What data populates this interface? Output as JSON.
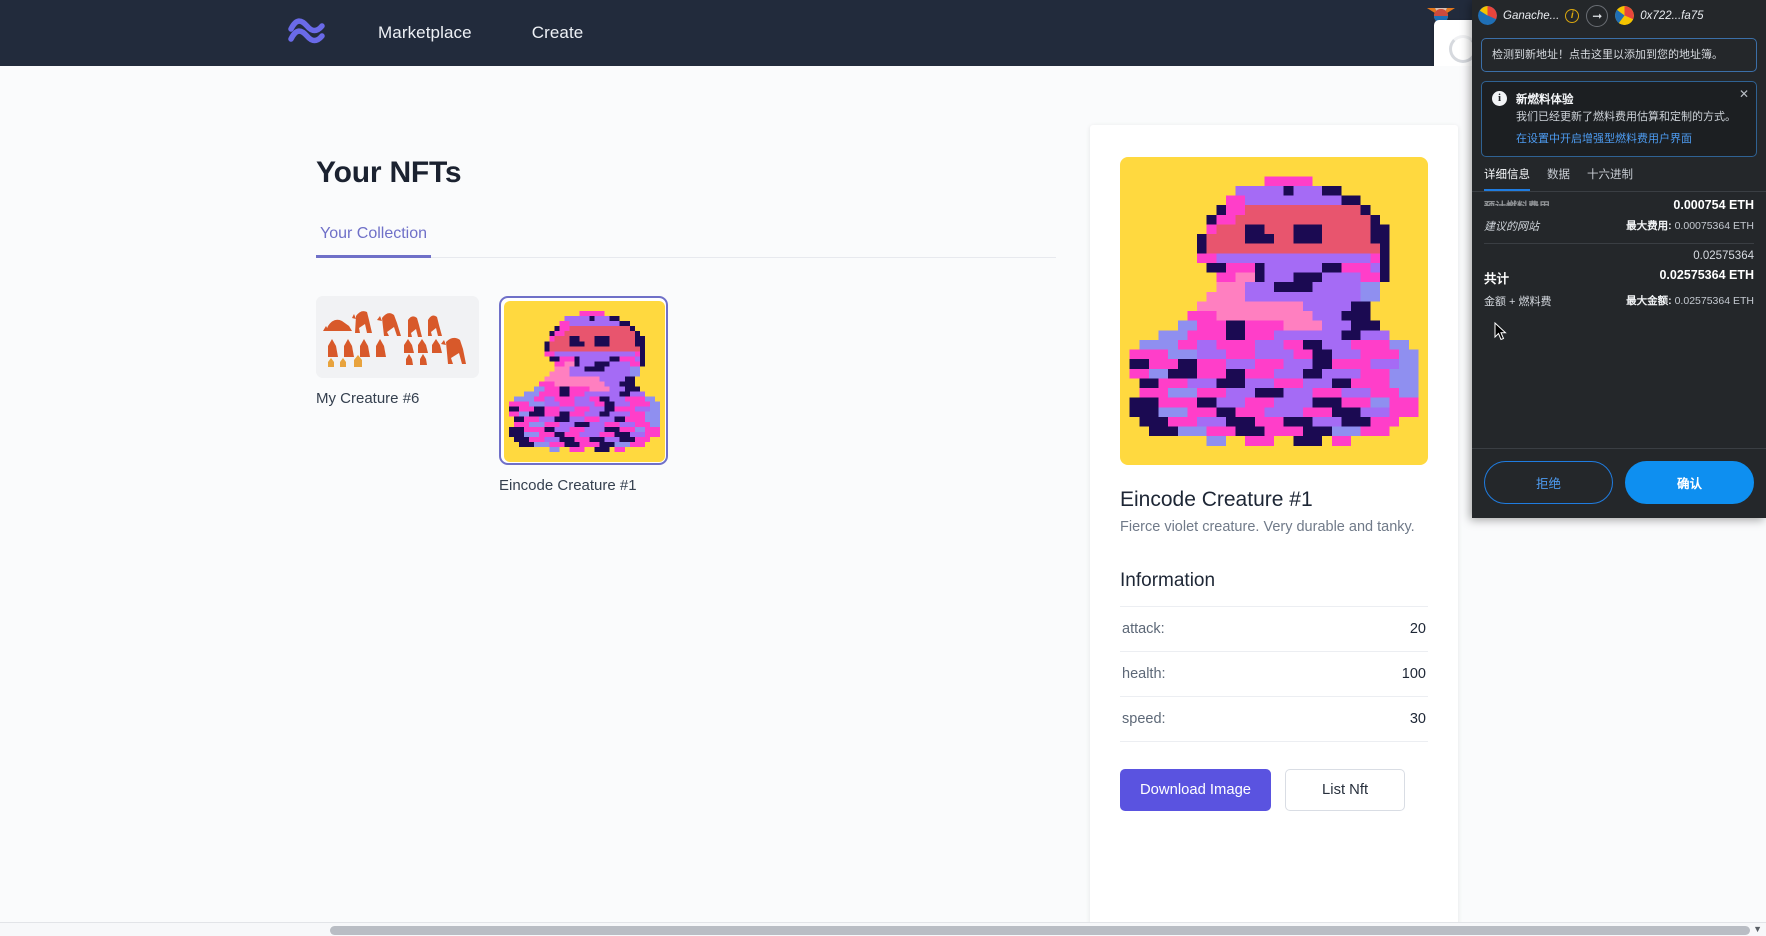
{
  "navbar": {
    "logo_icon": "wave-logo-icon",
    "links": [
      {
        "label": "Marketplace"
      },
      {
        "label": "Create"
      }
    ],
    "network_badge": {
      "label": "Ganache",
      "dot_color": "#6b5bd6",
      "bg": "#f3eafc",
      "text_color": "#6b2fa0"
    },
    "bg_color": "#222b3c"
  },
  "main": {
    "page_title": "Your NFTs",
    "tabs": [
      {
        "label": "Your Collection",
        "active": true
      }
    ],
    "nft_cards": [
      {
        "label": "My Creature #6",
        "selected": false,
        "kind": "sprite-sheet"
      },
      {
        "label": "Eincode Creature #1",
        "selected": true,
        "kind": "pixel-octopus"
      }
    ]
  },
  "detail": {
    "title": "Eincode Creature #1",
    "description": "Fierce violet creature. Very durable and tanky.",
    "information_heading": "Information",
    "stats": [
      {
        "key": "attack:",
        "value": "20"
      },
      {
        "key": "health:",
        "value": "100"
      },
      {
        "key": "speed:",
        "value": "30"
      }
    ],
    "download_button": "Download Image",
    "list_button": "List Nft",
    "accent_color": "#5a53e0",
    "image_bg": "#ffd93f"
  },
  "metamask": {
    "account_name": "Ganache...",
    "info_icon": "info-circle-icon",
    "arrow_icon": "arrow-right-icon",
    "to_address": "0x722...fa75",
    "new_address_notice": "检测到新地址！点击这里以添加到您的地址簿。",
    "gas_banner": {
      "title": "新燃料体验",
      "description": "我们已经更新了燃料费用估算和定制的方式。",
      "link": "在设置中开启增强型燃料费用户界面",
      "close_icon": "close-icon"
    },
    "tabs": [
      {
        "label": "详细信息",
        "active": true
      },
      {
        "label": "数据",
        "active": false
      },
      {
        "label": "十六进制",
        "active": false
      }
    ],
    "gas_row": {
      "label_clipped": "预计燃料费用",
      "amount": "0.000754 ETH",
      "source": "建议的网站",
      "max_label": "最大费用:",
      "max_value": "0.00075364 ETH"
    },
    "total_row": {
      "label": "共计",
      "amount_plain": "0.02575364",
      "amount_bold": "0.02575364 ETH",
      "sub_label": "金额 + 燃料费",
      "max_label": "最大金额:",
      "max_value": "0.02575364 ETH"
    },
    "reject_button": "拒绝",
    "confirm_button": "确认",
    "bg_color": "#24272a",
    "confirm_color": "#0e8ff0"
  }
}
